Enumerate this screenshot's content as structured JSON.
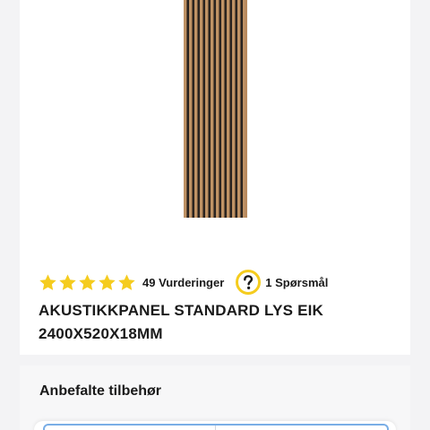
{
  "product": {
    "rating_count_label": "49 Vurderinger",
    "question_count_label": "1 Spørsmål",
    "title": "AKUSTIKKPANEL STANDARD LYS EIK 2400X520X18MM",
    "stars": 5,
    "star_color": "#f5cc1e",
    "qa_icon_color": "#f5cc1e"
  },
  "accessories": {
    "title": "Anbefalte tilbehør"
  },
  "icons": [
    "star-icon",
    "question-circle-icon"
  ]
}
